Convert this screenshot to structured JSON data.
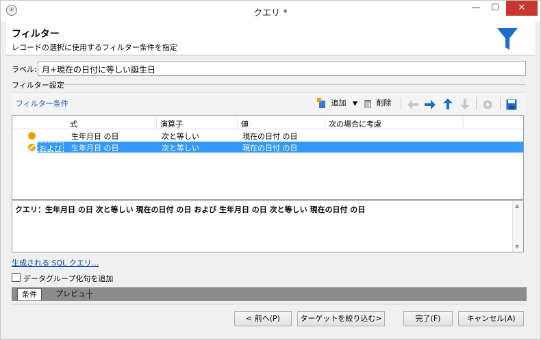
{
  "window": {
    "title": "クエリ *"
  },
  "header": {
    "title": "フィルター",
    "subtitle": "レコードの選択に使用するフィルター条件を指定"
  },
  "label_field": {
    "caption": "ラベル:",
    "value": "月+現在の日付に等しい誕生日"
  },
  "filter_settings": {
    "title": "フィルター設定"
  },
  "toolbar": {
    "title": "フィルター条件",
    "add_label": "追加",
    "delete_label": "削除"
  },
  "grid": {
    "columns": [
      "式",
      "演算子",
      "値",
      "次の場合に考慮"
    ],
    "rows": [
      {
        "logic": "",
        "expr": "生年月日 の日",
        "op": "次と等しい",
        "value": "現在の日付 の日"
      },
      {
        "logic": "および",
        "expr": "生年月日 の日",
        "op": "次と等しい",
        "value": "現在の日付 の日"
      }
    ]
  },
  "query": {
    "text": "クエリ：生年月日 の日 次と等しい 現在の日付 の日 および 生年月日 の日 次と等しい 現在の日付 の日"
  },
  "sql_link": "生成される SQL クエリ...",
  "checkbox": {
    "label": "データグループ化句を追加",
    "checked": false
  },
  "tabs": [
    "条件",
    "プレビュー"
  ],
  "buttons": {
    "prev": "< 前へ(P)",
    "target": "ターゲットを絞り込む>",
    "finish": "完了(F)",
    "cancel": "キャンセル(A)"
  },
  "colors": {
    "accent": "#1a6fc9",
    "selection": "#3399ff",
    "close": "#c7372f",
    "dot": "#f0a000"
  }
}
